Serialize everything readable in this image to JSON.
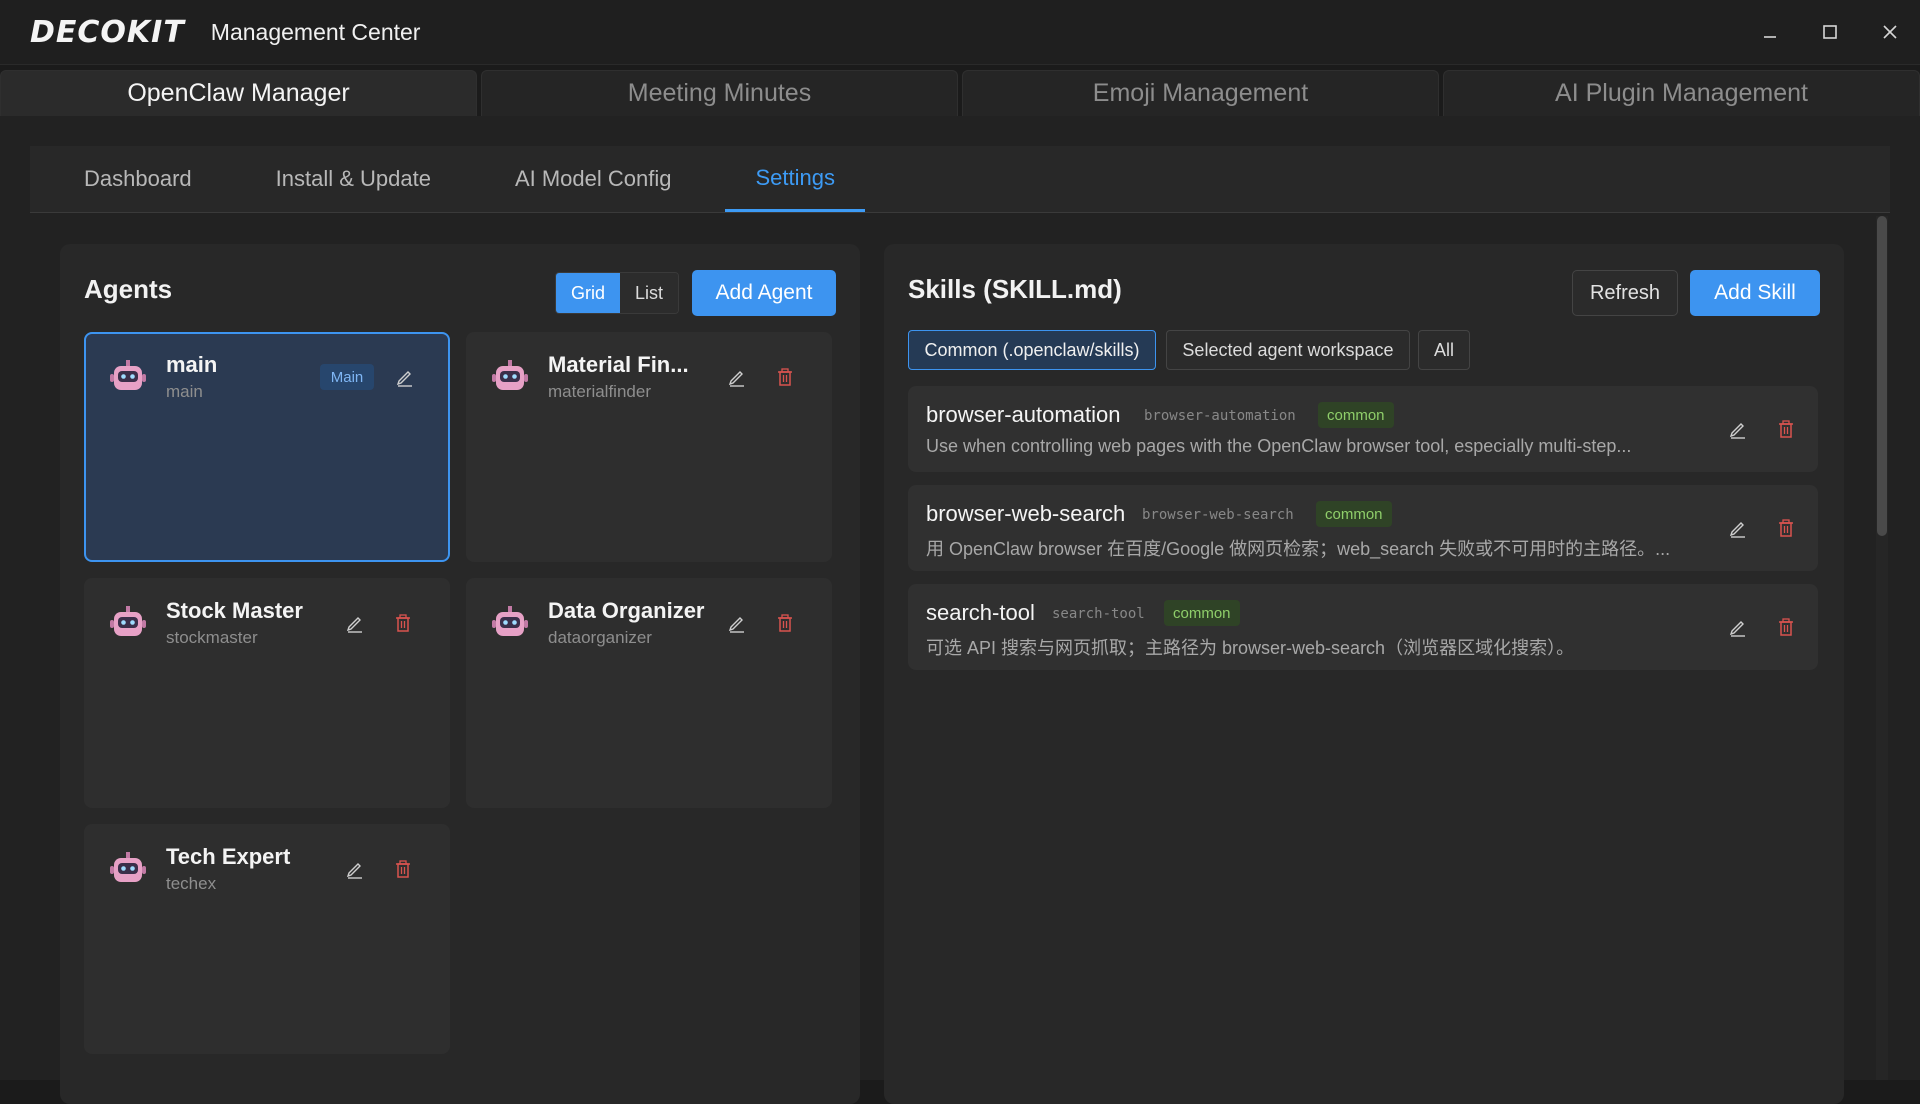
{
  "window": {
    "logo": "DECOKIT",
    "title": "Management Center",
    "controls": {
      "minimize": "minimize-icon",
      "maximize": "maximize-icon",
      "close": "close-icon"
    }
  },
  "main_tabs": [
    {
      "label": "OpenClaw Manager",
      "active": true
    },
    {
      "label": "Meeting Minutes"
    },
    {
      "label": "Emoji Management"
    },
    {
      "label": "AI Plugin Management"
    }
  ],
  "sub_tabs": [
    {
      "label": "Dashboard"
    },
    {
      "label": "Install & Update"
    },
    {
      "label": "AI Model Config"
    },
    {
      "label": "Settings",
      "active": true
    }
  ],
  "agents": {
    "title": "Agents",
    "view_modes": {
      "grid": "Grid",
      "list": "List",
      "selected": "Grid"
    },
    "add_label": "Add Agent",
    "items": [
      {
        "name": "main",
        "id": "main",
        "badge": "Main",
        "selected": true
      },
      {
        "name": "Material Fin...",
        "id": "materialfinder"
      },
      {
        "name": "Stock Master",
        "id": "stockmaster"
      },
      {
        "name": "Data Organizer",
        "id": "dataorganizer"
      },
      {
        "name": "Tech Expert",
        "id": "techex"
      }
    ]
  },
  "skills": {
    "title": "Skills (SKILL.md)",
    "refresh_label": "Refresh",
    "add_label": "Add Skill",
    "filters": [
      {
        "label": "Common (.openclaw/skills)",
        "active": true
      },
      {
        "label": "Selected agent workspace"
      },
      {
        "label": "All"
      }
    ],
    "items": [
      {
        "name": "browser-automation",
        "slug": "browser-automation",
        "tag": "common",
        "description": "Use when controlling web pages with the OpenClaw browser tool, especially multi-step..."
      },
      {
        "name": "browser-web-search",
        "slug": "browser-web-search",
        "tag": "common",
        "description": "用 OpenClaw browser 在百度/Google 做网页检索；web_search 失败或不可用时的主路径。..."
      },
      {
        "name": "search-tool",
        "slug": "search-tool",
        "tag": "common",
        "description": "可选 API 搜索与网页抓取；主路径为 browser-web-search（浏览器区域化搜索）。"
      }
    ]
  },
  "colors": {
    "accent": "#3d94f0",
    "danger": "#d9534f",
    "tag_bg": "#2f4326",
    "tag_fg": "#8fce6a"
  }
}
